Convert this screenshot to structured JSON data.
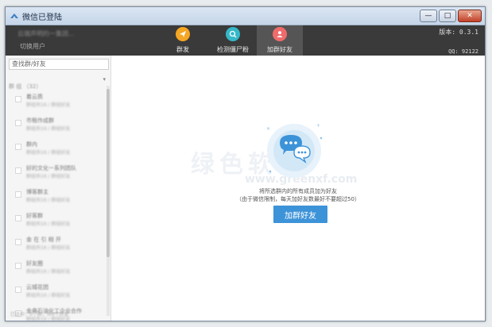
{
  "window": {
    "title": "微信已登陆",
    "buttons": {
      "minimize": "—",
      "maximize": "□",
      "close": "✕"
    }
  },
  "header": {
    "user_name": "云端声明的一集团...",
    "switch_user": "切换用户",
    "version": "版本: 0.3.1",
    "qq": "QQ: 92122",
    "tabs": [
      {
        "label": "群发",
        "icon": "send-icon",
        "color": "#f5a623"
      },
      {
        "label": "检测僵尸粉",
        "icon": "scan-icon",
        "color": "#35b8c8"
      },
      {
        "label": "加群好友",
        "icon": "person-icon",
        "color": "#ef6b6b"
      }
    ]
  },
  "sidebar": {
    "search_placeholder": "查找群/好友",
    "group_header": "群 组 （32）",
    "caret": "▾",
    "groups": [
      {
        "name": "着云质",
        "sub": "群组共16 / 群组好友"
      },
      {
        "name": "市租作成群",
        "sub": "群组共16 / 群组好友"
      },
      {
        "name": "群内",
        "sub": "群组共16 / 群组好友"
      },
      {
        "name": "好的文化一系列团队",
        "sub": "群组共16 / 群组好友"
      },
      {
        "name": "博客群主",
        "sub": "群组共16 / 群组好友"
      },
      {
        "name": "好客群",
        "sub": "群组共16 / 群组好友"
      },
      {
        "name": "金 在 引 相 开",
        "sub": "群组共16 / 群组好友"
      },
      {
        "name": "好友圈",
        "sub": "群组共16 / 群组好友"
      },
      {
        "name": "云城花团",
        "sub": "群组共16 / 群组好友"
      },
      {
        "name": "金典石油化工企业合作",
        "sub": "群组共16 / 群组好友"
      }
    ],
    "footer": "已选中：0个群，共0个好友"
  },
  "main": {
    "desc_line1": "将所选群内的所有成员加为好友",
    "desc_line2": "（由于微信限制，每天加好友数最好不要超过50）",
    "add_button": "加群好友",
    "watermark": "绿色软件",
    "watermark_url": "www.greenxf.com"
  },
  "colors": {
    "accent": "#3d93d8",
    "header_bg": "#3a3a3a",
    "illustration": "#3d93d8"
  }
}
